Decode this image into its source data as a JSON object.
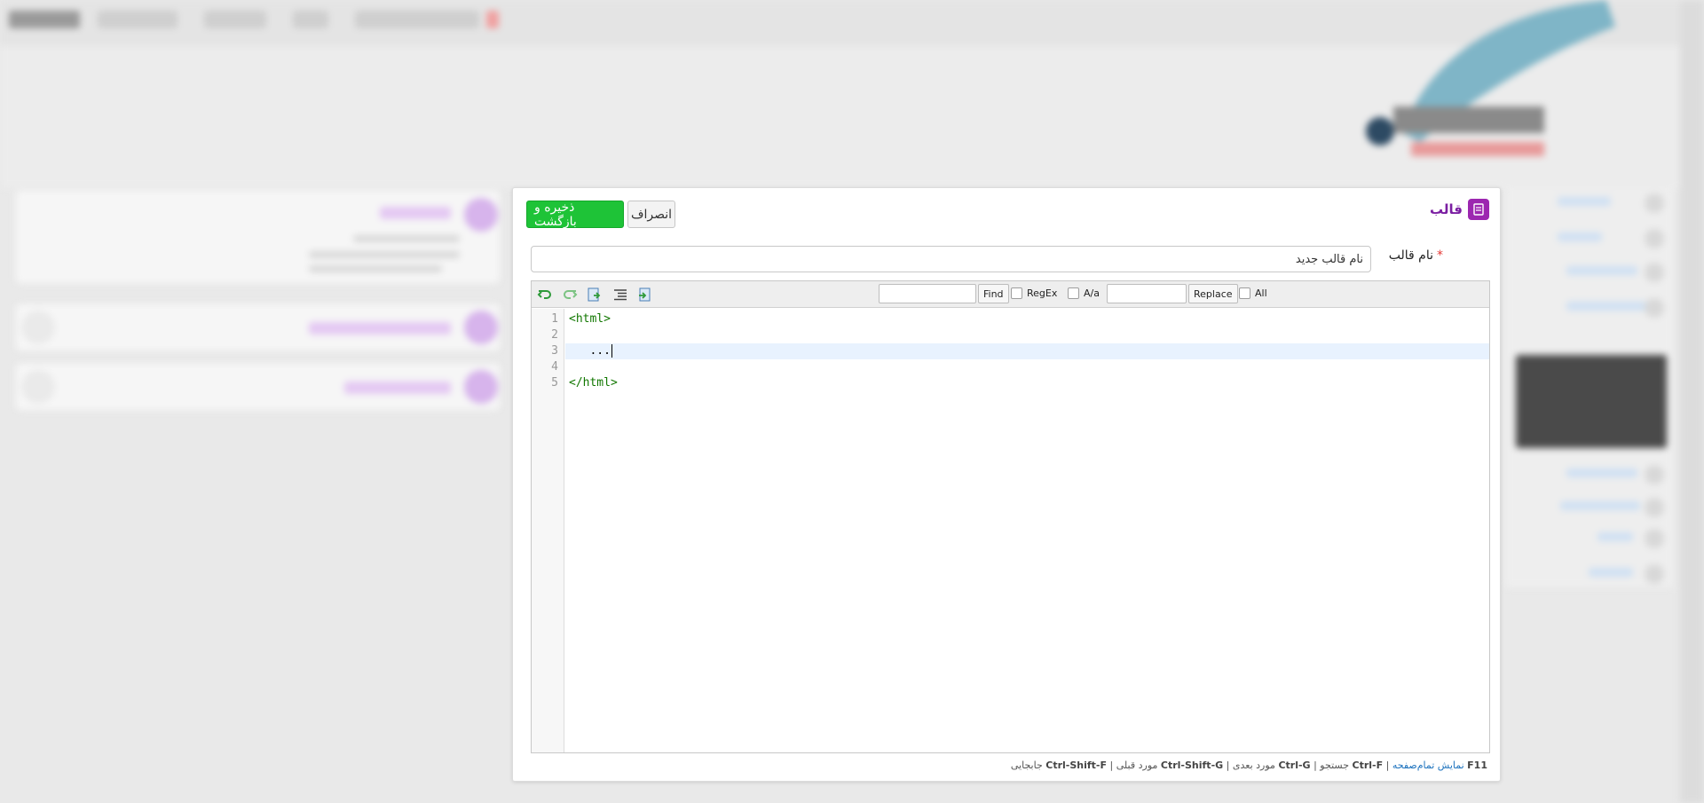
{
  "panel": {
    "title": "قالب",
    "save_label": "ذخیره و بازگشت",
    "cancel_label": "انصراف"
  },
  "form": {
    "name_label": "نام قالب",
    "required_mark": "*",
    "name_value": "نام قالب جدید"
  },
  "toolbar": {
    "find_label": "Find",
    "regex_label": "RegEx",
    "case_label": "A/a",
    "replace_label": "Replace",
    "all_label": "All",
    "find_value": "",
    "replace_value": ""
  },
  "editor": {
    "lines": [
      "1",
      "2",
      "3",
      "4",
      "5"
    ],
    "code": [
      "<html>",
      "",
      "   ...",
      "",
      "</html>"
    ],
    "active_line": 3
  },
  "shortcuts": {
    "f11_key": "F11",
    "f11_label": "نمایش تمام‌صفحه",
    "search_key": "Ctrl-F",
    "search_label": "جستجو",
    "next_key": "Ctrl-G",
    "next_label": "مورد بعدی",
    "prev_key": "Ctrl-Shift-G",
    "prev_label": "مورد قبلی",
    "replace_key": "Ctrl-Shift-F",
    "replace_label": "جابجایی",
    "separator": "|"
  },
  "colors": {
    "save_green": "#1ec337",
    "title_purple": "#7b1fa2",
    "tag_green": "#117700",
    "required_red": "#e53935",
    "link_blue": "#1e73be"
  }
}
